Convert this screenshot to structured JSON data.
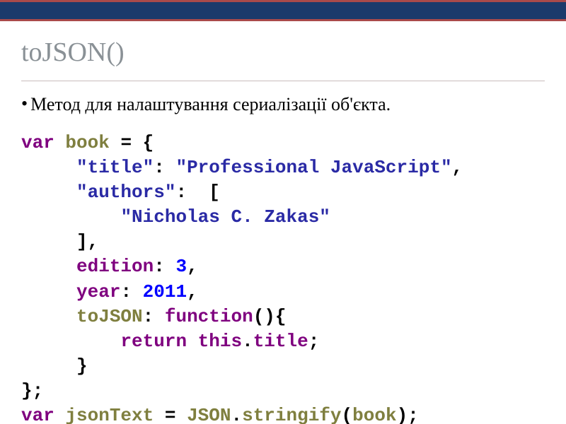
{
  "slide": {
    "title": "toJSON()",
    "bullet": "Метод для налаштування сериалізації об'єкта."
  },
  "code": {
    "tok": {
      "var": "var",
      "sp": " ",
      "book": "book",
      "eq": " = {",
      "indent1": "     ",
      "indent2": "         ",
      "q": "\"",
      "title_k": "title",
      "colon_sp": ": ",
      "title_v": "Professional JavaScript",
      "comma": ",",
      "authors_k": "authors",
      "lbrak": " [",
      "zakas": "Nicholas C. Zakas",
      "rbrak": "]",
      "edition_k": "edition",
      "edition_v": "3",
      "year_k": "year",
      "year_v": "2011",
      "toJSON_k": "toJSON",
      "function_kw": "function",
      "fn_parens_open": "(){",
      "return_kw": "return",
      "this_kw": "this",
      "dot": ".",
      "title_prop": "title",
      "semicolon": ";",
      "rbrace": "}",
      "obj_close": "};",
      "jsonText": "jsonText",
      "eq2": " = ",
      "JSON": "JSON",
      "stringify": "stringify",
      "lp": "(",
      "rp": ")"
    }
  }
}
